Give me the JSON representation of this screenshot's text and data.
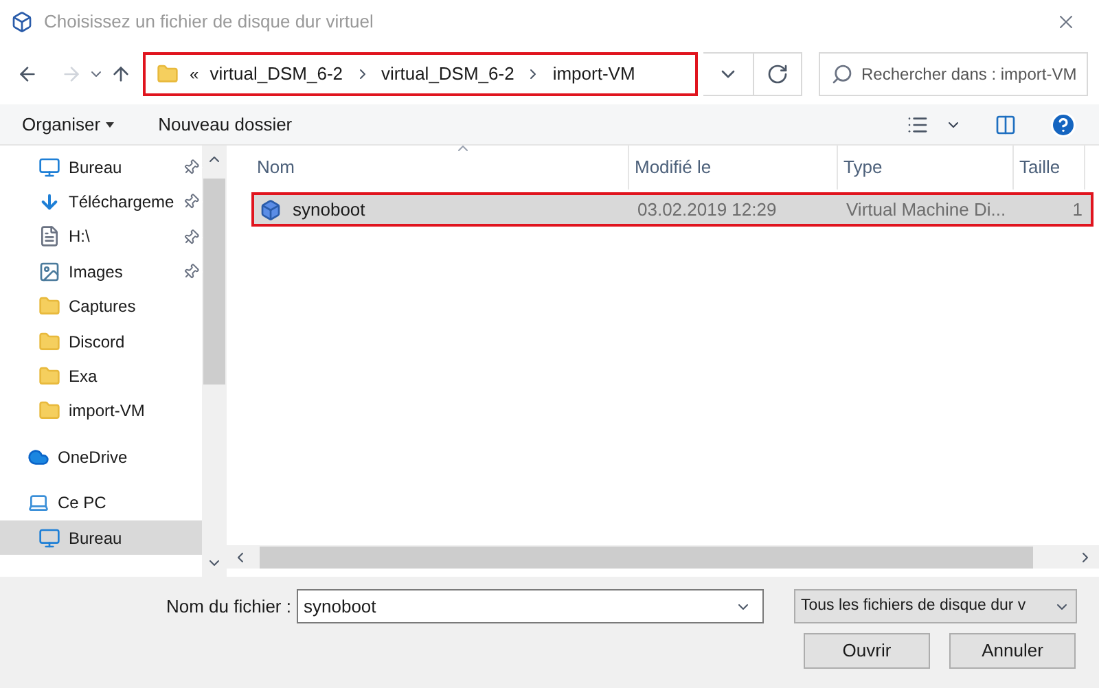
{
  "window": {
    "title": "Choisissez un fichier de disque dur virtuel"
  },
  "address_bar": {
    "overflow": "«",
    "highlighted": true,
    "crumbs": [
      "virtual_DSM_6-2",
      "virtual_DSM_6-2",
      "import-VM"
    ]
  },
  "search": {
    "placeholder": "Rechercher dans : import-VM"
  },
  "toolbar": {
    "organize": "Organiser",
    "new_folder": "Nouveau dossier"
  },
  "sidebar": {
    "items": [
      {
        "label": "Bureau",
        "kind": "desktop",
        "pinned": true,
        "selected": false
      },
      {
        "label": "Téléchargeme",
        "kind": "download",
        "pinned": true,
        "selected": false
      },
      {
        "label": "H:\\",
        "kind": "drive",
        "pinned": true,
        "selected": false
      },
      {
        "label": "Images",
        "kind": "images",
        "pinned": true,
        "selected": false
      },
      {
        "label": "Captures",
        "kind": "folder",
        "pinned": false,
        "selected": false
      },
      {
        "label": "Discord",
        "kind": "folder",
        "pinned": false,
        "selected": false
      },
      {
        "label": "Exa",
        "kind": "folder",
        "pinned": false,
        "selected": false
      },
      {
        "label": "import-VM",
        "kind": "folder",
        "pinned": false,
        "selected": false
      },
      {
        "label": "OneDrive",
        "kind": "cloud",
        "pinned": false,
        "selected": false
      },
      {
        "label": "Ce PC",
        "kind": "pc",
        "pinned": false,
        "selected": false
      },
      {
        "label": "Bureau",
        "kind": "desktop",
        "pinned": false,
        "selected": true
      }
    ]
  },
  "table": {
    "columns": [
      "Nom",
      "Modifié le",
      "Type",
      "Taille"
    ],
    "rows": [
      {
        "cells": [
          "synoboot",
          "03.02.2019 12:29",
          "Virtual Machine Di...",
          "1"
        ],
        "selected": true,
        "highlighted": true
      }
    ]
  },
  "footer": {
    "filename_label": "Nom du fichier :",
    "filename": "synoboot",
    "filter": "Tous les fichiers de disque dur v",
    "buttons": [
      "Ouvrir",
      "Annuler"
    ]
  }
}
